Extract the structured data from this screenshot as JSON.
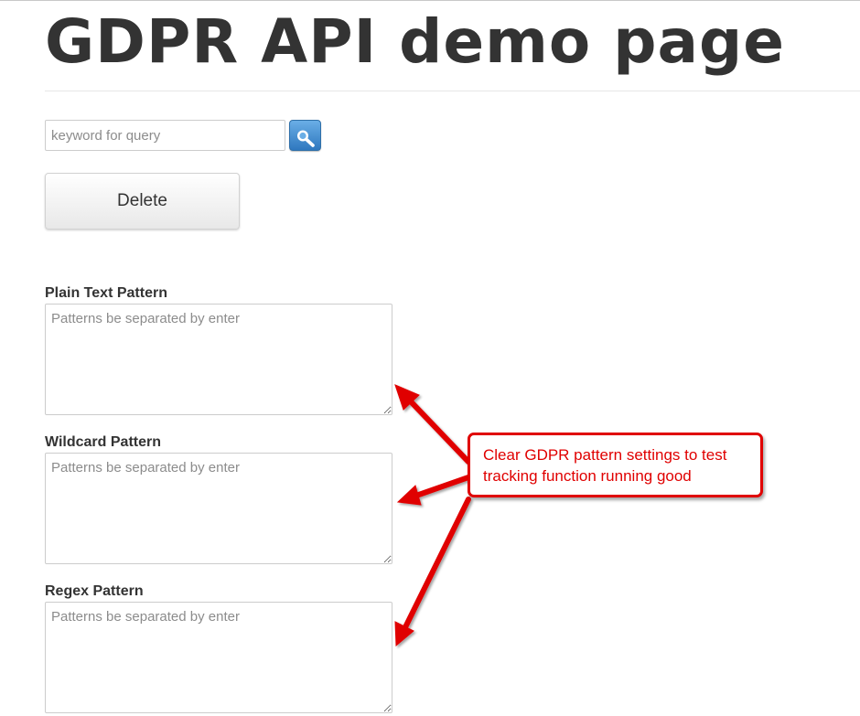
{
  "header": {
    "title": "GDPR API demo page"
  },
  "search": {
    "placeholder": "keyword for query",
    "value": "",
    "button_icon": "search-icon"
  },
  "actions": {
    "delete_label": "Delete"
  },
  "patterns": {
    "plain_text": {
      "label": "Plain Text Pattern",
      "placeholder": "Patterns be separated by enter",
      "value": ""
    },
    "wildcard": {
      "label": "Wildcard Pattern",
      "placeholder": "Patterns be separated by enter",
      "value": ""
    },
    "regex": {
      "label": "Regex Pattern",
      "placeholder": "Patterns be separated by enter",
      "value": ""
    }
  },
  "annotation": {
    "text": "Clear GDPR pattern settings to test tracking function running good",
    "color": "#e00000"
  },
  "colors": {
    "text": "#333333",
    "search_button": "#2f78bf"
  }
}
